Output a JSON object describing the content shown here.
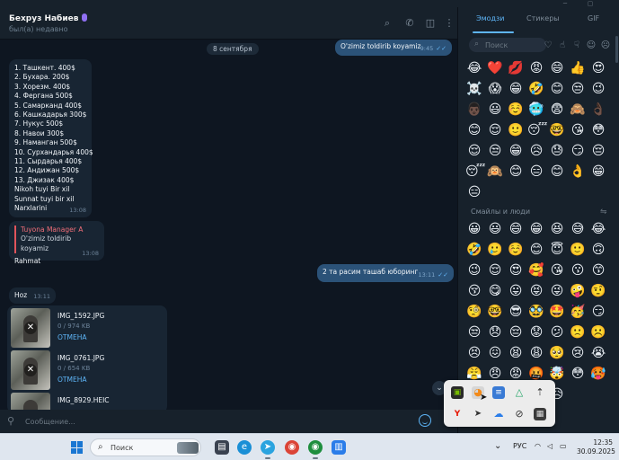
{
  "window": {
    "minimize": "─",
    "maximize": "▢"
  },
  "header": {
    "name": "Бехруз Набиев",
    "status": "был(а) недавно"
  },
  "chat": {
    "date": "8 сентября",
    "msg_out1": {
      "text": "O'zimiz toldirib koyamiz",
      "time": "9:45",
      "ticks": "✓✓"
    },
    "msg_list": {
      "lines": [
        "1. Ташкент. 400$",
        "2. Бухара. 200$",
        "3. Хорезм. 400$",
        "4. Фергана 500$",
        "5. Самарканд 400$",
        "6. Кашкадарья 300$",
        "7. Нукус 500$",
        "8. Навои 300$",
        "9. Наманган 500$",
        "10. Сурхандарья 400$",
        "11. Сырдарья 400$",
        "12. Андижан 500$",
        "13. Джизак 400$",
        "Nikoh tuyi   Bir xil",
        "Sunnat tuyi  bir xil",
        "Narxlarini"
      ],
      "time": "13:08"
    },
    "msg_reply": {
      "reply_name": "Tuyona Manager A",
      "reply_text": "O'zimiz toldirib koyamiz",
      "text": "Rahmat",
      "time": "13:08"
    },
    "msg_out2": {
      "text": "2 та расим ташаб юборинг",
      "time": "13:11",
      "ticks": "✓✓"
    },
    "msg_hoz": {
      "text": "Hoz",
      "time": "13:11"
    },
    "files": [
      {
        "name": "IMG_1592.JPG",
        "size": "0 / 974 KB",
        "cancel": "ОТМЕНА"
      },
      {
        "name": "IMG_0761.JPG",
        "size": "0 / 654 KB",
        "cancel": "ОТМЕНА"
      },
      {
        "name": "IMG_8929.HEIC",
        "size": "",
        "cancel": ""
      }
    ]
  },
  "input": {
    "placeholder": "Сообщение..."
  },
  "emoji_panel": {
    "tabs": [
      "Эмодзи",
      "Стикеры",
      "GIF"
    ],
    "search_placeholder": "Поиск",
    "section_title": "Смайлы и люди",
    "recent": [
      "😂",
      "❤️",
      "💋",
      "😡",
      "😄",
      "👍",
      "😍",
      "☠️",
      "😱",
      "😁",
      "🤣",
      "😊",
      "😒",
      "😉",
      "👨🏿",
      "😃",
      "☺️",
      "🥶",
      "😨",
      "🙈",
      "👌🏿",
      "😊",
      "😌",
      "🙂",
      "😴",
      "🤓",
      "😘",
      "😳",
      "😌",
      "😒",
      "😁",
      "😥",
      "😓",
      "😏",
      "😔",
      "😴",
      "🙉",
      "😊",
      "😑",
      "😊",
      "👌",
      "😁",
      "😑"
    ],
    "smileys": [
      "😀",
      "😃",
      "😄",
      "😁",
      "😆",
      "😅",
      "😂",
      "🤣",
      "🥲",
      "☺️",
      "😊",
      "😇",
      "🙂",
      "🙃",
      "😉",
      "😌",
      "😍",
      "🥰",
      "😘",
      "😗",
      "😙",
      "😚",
      "😋",
      "😛",
      "😝",
      "😜",
      "🤪",
      "🤨",
      "🧐",
      "🤓",
      "😎",
      "🥸",
      "🤩",
      "🥳",
      "😏",
      "😒",
      "😞",
      "😔",
      "😟",
      "😕",
      "🙁",
      "☹️",
      "😣",
      "😖",
      "😫",
      "😩",
      "🥺",
      "😢",
      "😭",
      "😤",
      "😠",
      "😡",
      "🤬",
      "🤯",
      "😳",
      "🥵",
      "🥶",
      "😱",
      "😨",
      "😰",
      "😥"
    ],
    "tray_partial": "🥺"
  },
  "tray_popup": {
    "icons": [
      "nvidia-icon",
      "orange-app-icon",
      "stack-icon",
      "drive-icon",
      "usb-icon",
      "yandex-icon",
      "telegram-icon",
      "cloud-icon",
      "sync-icon",
      "taskbar-app-icon"
    ]
  },
  "taskbar": {
    "search_label": "Поиск",
    "lang": "РУС",
    "time": "12:35",
    "date": "30.09.2025"
  }
}
